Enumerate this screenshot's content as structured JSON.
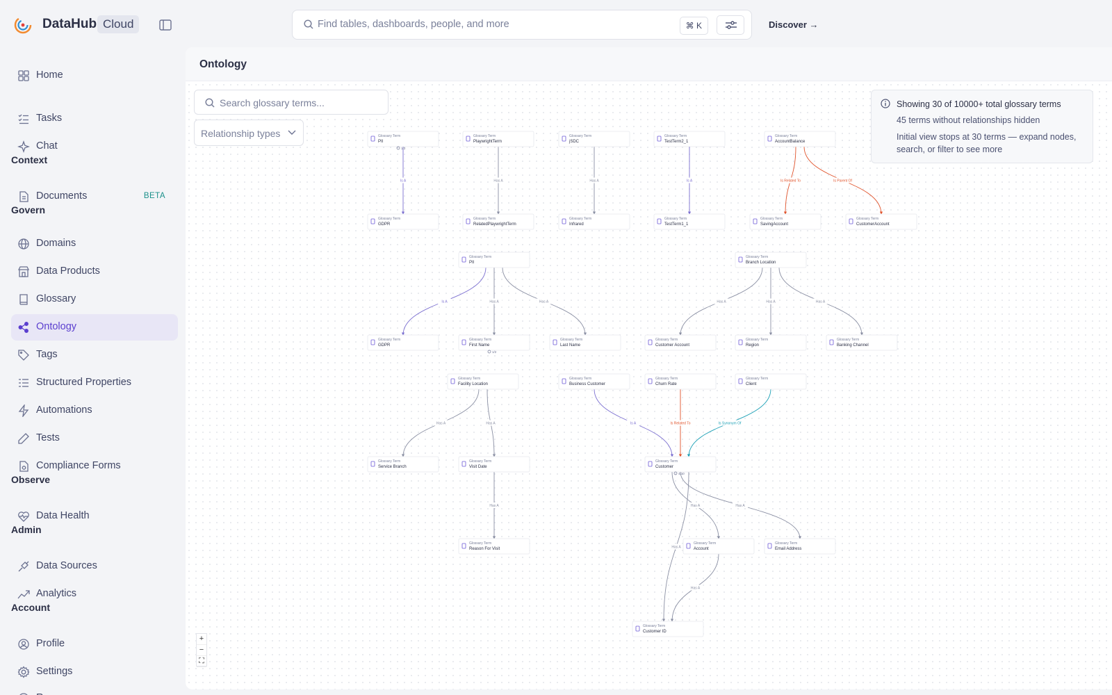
{
  "header": {
    "brand": "DataHub",
    "badge": "Cloud",
    "search_placeholder": "Find tables, dashboards, people, and more",
    "shortcut": "⌘ K",
    "discover": "Discover →"
  },
  "sidebar": {
    "items": [
      {
        "label": "Home",
        "icon": "home-icon"
      },
      {
        "label": "Tasks",
        "icon": "tasks-icon"
      },
      {
        "label": "Chat",
        "icon": "sparkle-icon"
      },
      {
        "label": "Documents",
        "icon": "document-icon",
        "badge": "BETA"
      },
      {
        "label": "Domains",
        "icon": "globe-icon"
      },
      {
        "label": "Data Products",
        "icon": "store-icon"
      },
      {
        "label": "Glossary",
        "icon": "book-icon"
      },
      {
        "label": "Ontology",
        "icon": "share-icon"
      },
      {
        "label": "Tags",
        "icon": "tag-icon"
      },
      {
        "label": "Structured Properties",
        "icon": "list-icon"
      },
      {
        "label": "Automations",
        "icon": "lightning-icon"
      },
      {
        "label": "Tests",
        "icon": "pencil-icon"
      },
      {
        "label": "Compliance Forms",
        "icon": "form-icon"
      },
      {
        "label": "Data Health",
        "icon": "heart-pulse-icon"
      },
      {
        "label": "Data Sources",
        "icon": "plug-icon"
      },
      {
        "label": "Analytics",
        "icon": "trend-icon"
      },
      {
        "label": "Profile",
        "icon": "user-circle-icon"
      },
      {
        "label": "Settings",
        "icon": "gear-icon"
      },
      {
        "label": "Resources",
        "icon": "help-icon"
      }
    ],
    "sections": [
      "Context",
      "Govern",
      "Observe",
      "Admin",
      "Account"
    ]
  },
  "main": {
    "title": "Ontology",
    "glossary_search_placeholder": "Search glossary terms...",
    "relationship_filter": "Relationship types",
    "info": {
      "line1": "Showing 30 of 10000+ total glossary terms",
      "line2": "45 terms without relationships hidden",
      "line3": "Initial view stops at 30 terms — expand nodes, search, or filter to see more"
    },
    "zoom": [
      "+",
      "−",
      "⛶"
    ]
  },
  "graph": {
    "node_type_label": "Glossary Term",
    "colors": {
      "has_a": "#8a8fa3",
      "is_a": "#7b6fd0",
      "related": "#e0522a",
      "synonym": "#1a9fb5"
    },
    "nodes": [
      {
        "id": "n1",
        "name": "PII",
        "badge": "1/3"
      },
      {
        "id": "n2",
        "name": "PlaywrightTerm"
      },
      {
        "id": "n3",
        "name": "jSDC"
      },
      {
        "id": "n4",
        "name": "TestTerm2_1"
      },
      {
        "id": "n5",
        "name": "AccountBalance"
      },
      {
        "id": "n6",
        "name": "GDPR"
      },
      {
        "id": "n7",
        "name": "RelatedPlaywrightTerm"
      },
      {
        "id": "n8",
        "name": "Infrared"
      },
      {
        "id": "n9",
        "name": "TestTerm1_1"
      },
      {
        "id": "n10",
        "name": "SavingAccount"
      },
      {
        "id": "n11",
        "name": "CustomerAccount"
      },
      {
        "id": "n12",
        "name": "PII"
      },
      {
        "id": "n13",
        "name": "Branch Location"
      },
      {
        "id": "n14",
        "name": "GDPR"
      },
      {
        "id": "n15",
        "name": "First Name",
        "badge": "1/2"
      },
      {
        "id": "n16",
        "name": "Last Name"
      },
      {
        "id": "n17",
        "name": "Customer Account"
      },
      {
        "id": "n18",
        "name": "Region"
      },
      {
        "id": "n19",
        "name": "Banking Channel"
      },
      {
        "id": "n20",
        "name": "Facility Location"
      },
      {
        "id": "n21",
        "name": "Business Customer"
      },
      {
        "id": "n22",
        "name": "Churn Rate"
      },
      {
        "id": "n23",
        "name": "Client"
      },
      {
        "id": "n24",
        "name": "Service Branch"
      },
      {
        "id": "n25",
        "name": "Visit Date"
      },
      {
        "id": "n26",
        "name": "Customer",
        "badge": "4/10"
      },
      {
        "id": "n27",
        "name": "Reason For Visit"
      },
      {
        "id": "n28",
        "name": "Account"
      },
      {
        "id": "n29",
        "name": "Email Address"
      },
      {
        "id": "n30",
        "name": "Customer ID"
      }
    ],
    "edges": [
      {
        "from": "n1",
        "to": "n6",
        "label": "Is A",
        "kind": "is_a"
      },
      {
        "from": "n2",
        "to": "n7",
        "label": "Has A",
        "kind": "has_a"
      },
      {
        "from": "n3",
        "to": "n8",
        "label": "Has A",
        "kind": "has_a"
      },
      {
        "from": "n4",
        "to": "n9",
        "label": "Is A",
        "kind": "is_a"
      },
      {
        "from": "n5",
        "to": "n10",
        "label": "Is Related To",
        "kind": "related"
      },
      {
        "from": "n5",
        "to": "n11",
        "label": "Is Parent Of",
        "kind": "related"
      },
      {
        "from": "n12",
        "to": "n14",
        "label": "Is A",
        "kind": "is_a"
      },
      {
        "from": "n12",
        "to": "n15",
        "label": "Has A",
        "kind": "has_a"
      },
      {
        "from": "n12",
        "to": "n16",
        "label": "Has A",
        "kind": "has_a"
      },
      {
        "from": "n13",
        "to": "n17",
        "label": "Has A",
        "kind": "has_a"
      },
      {
        "from": "n13",
        "to": "n18",
        "label": "Has A",
        "kind": "has_a"
      },
      {
        "from": "n13",
        "to": "n19",
        "label": "Has A",
        "kind": "has_a"
      },
      {
        "from": "n20",
        "to": "n24",
        "label": "Has A",
        "kind": "has_a"
      },
      {
        "from": "n20",
        "to": "n25",
        "label": "Has A",
        "kind": "has_a"
      },
      {
        "from": "n21",
        "to": "n26",
        "label": "Is A",
        "kind": "is_a"
      },
      {
        "from": "n22",
        "to": "n26",
        "label": "Is Related To",
        "kind": "related"
      },
      {
        "from": "n23",
        "to": "n26",
        "label": "Is Synonym Of",
        "kind": "synonym"
      },
      {
        "from": "n25",
        "to": "n27",
        "label": "Has A",
        "kind": "has_a"
      },
      {
        "from": "n26",
        "to": "n28",
        "label": "Has A",
        "kind": "has_a"
      },
      {
        "from": "n26",
        "to": "n29",
        "label": "Has A",
        "kind": "has_a"
      },
      {
        "from": "n26",
        "to": "n30",
        "label": "Has A",
        "kind": "has_a"
      },
      {
        "from": "n28",
        "to": "n30",
        "label": "Has A",
        "kind": "has_a"
      }
    ]
  }
}
